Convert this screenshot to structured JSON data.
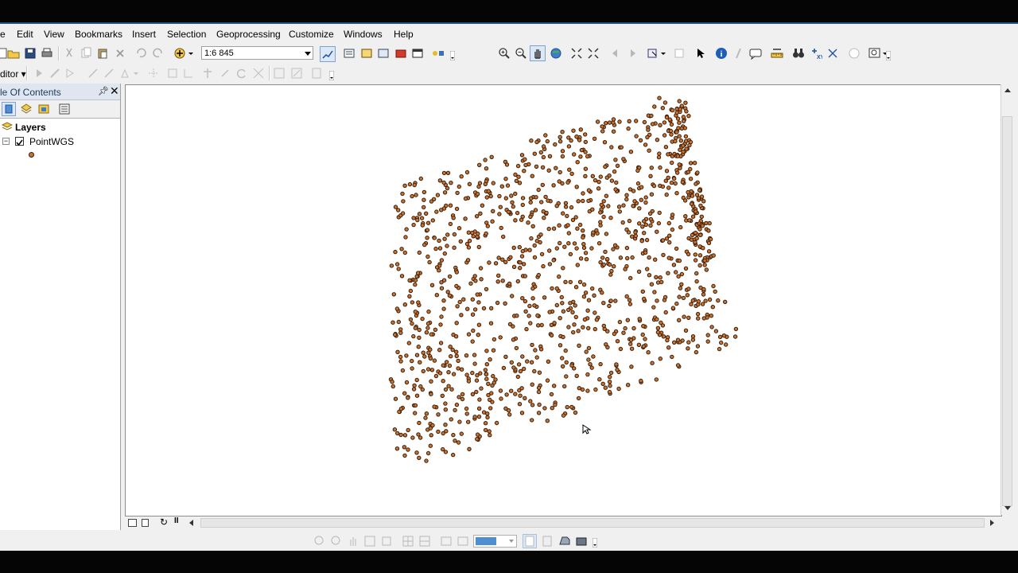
{
  "window": {
    "menu": [
      "e",
      "Edit",
      "View",
      "Bookmarks",
      "Insert",
      "Selection",
      "Geoprocessing",
      "Customize",
      "Windows",
      "Help"
    ]
  },
  "standard_toolbar": {
    "scale_value": "1:6 845"
  },
  "editor_toolbar": {
    "editor_label": "ditor ▾"
  },
  "toc": {
    "title": "le Of Contents",
    "root_label": "Layers",
    "layer_name": "PointWGS",
    "layer_checked": true
  },
  "map": {
    "symbol_fill": "#c87534",
    "symbol_stroke": "#3a1c08",
    "background": "#ffffff"
  },
  "layout_toolbar": {
    "zoom_value": ""
  },
  "icons": {
    "standard": [
      "new-icon",
      "open-icon",
      "save-icon",
      "print-icon",
      "cut-icon",
      "copy-icon",
      "paste-icon",
      "delete-icon",
      "undo-icon",
      "redo-icon",
      "add-data-icon"
    ],
    "tools": [
      "zoom-in-icon",
      "zoom-out-icon",
      "pan-icon",
      "full-extent-icon",
      "fixed-zoom-in-icon",
      "fixed-zoom-out-icon",
      "back-icon",
      "forward-icon",
      "select-features-icon",
      "clear-selection-icon",
      "select-elements-icon",
      "identify-icon",
      "hyperlink-icon",
      "html-popup-icon",
      "measure-icon",
      "find-icon",
      "go-to-xy-icon",
      "time-slider-icon",
      "create-viewer-icon"
    ]
  }
}
